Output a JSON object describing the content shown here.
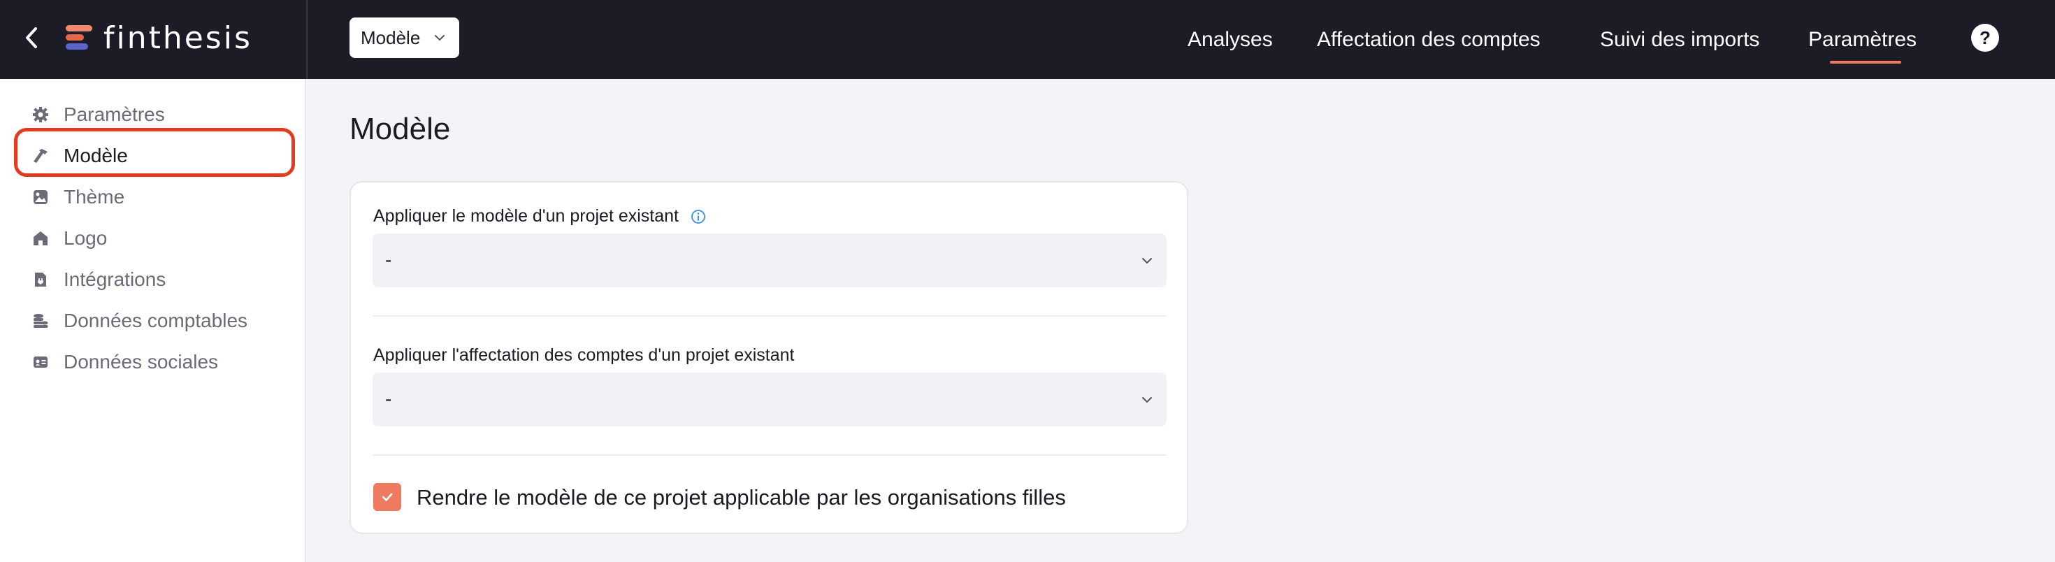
{
  "header": {
    "logo_text": "finthesis",
    "model_select": {
      "value": "Modèle"
    },
    "nav": [
      {
        "label": "Analyses"
      },
      {
        "label": "Affectation des comptes"
      },
      {
        "label": "Suivi des imports"
      },
      {
        "label": "Paramètres",
        "active": true
      }
    ],
    "help_label": "?"
  },
  "sidebar": {
    "items": [
      {
        "label": "Paramètres",
        "icon": "gear-icon"
      },
      {
        "label": "Modèle",
        "icon": "hammer-icon",
        "active": true
      },
      {
        "label": "Thème",
        "icon": "image-icon"
      },
      {
        "label": "Logo",
        "icon": "home-icon"
      },
      {
        "label": "Intégrations",
        "icon": "file-plug-icon"
      },
      {
        "label": "Données comptables",
        "icon": "coins-icon"
      },
      {
        "label": "Données sociales",
        "icon": "id-card-icon"
      }
    ]
  },
  "main": {
    "title": "Modèle",
    "fields": [
      {
        "label": "Appliquer le modèle d'un projet existant",
        "value": "-"
      },
      {
        "label": "Appliquer l'affectation des comptes d'un projet existant",
        "value": "-"
      }
    ],
    "checkbox": {
      "label": "Rendre le modèle de ce projet applicable par les organisations filles",
      "checked": true
    }
  },
  "colors": {
    "topbar": "#1c1c27",
    "accent": "#ee7a5f",
    "highlight_ring": "#e23b1f",
    "info": "#3b8de0"
  }
}
